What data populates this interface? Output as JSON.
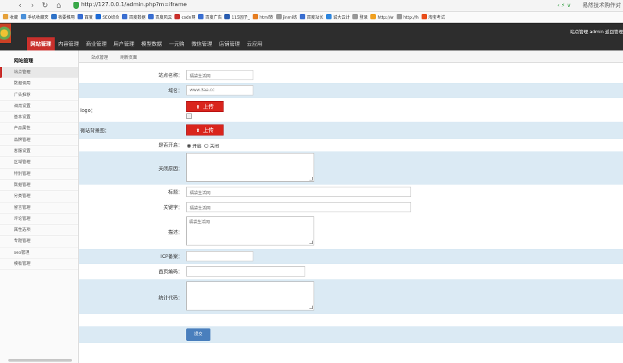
{
  "browser": {
    "url": "http://127.0.0.1/admin.php?m=iframe",
    "right_text": "易然技术购作对",
    "right_icons": "‹ ⚡ ∨"
  },
  "bookmarks": [
    {
      "label": "收藏",
      "color": "#e6a23c"
    },
    {
      "label": "手机收藏夹",
      "color": "#4a90d9"
    },
    {
      "label": "我要推用",
      "color": "#2f73c8"
    },
    {
      "label": "百度",
      "color": "#3b6fd1"
    },
    {
      "label": "SEO综合",
      "color": "#1e6bd6"
    },
    {
      "label": "百度数据",
      "color": "#3b6fd1"
    },
    {
      "label": "百度风云",
      "color": "#3b6fd1"
    },
    {
      "label": "csdn网",
      "color": "#c9302c"
    },
    {
      "label": "百度广告",
      "color": "#3b6fd1"
    },
    {
      "label": "115园子_",
      "color": "#2a5db0"
    },
    {
      "label": "html转",
      "color": "#e67e22"
    },
    {
      "label": "jinmi练",
      "color": "#999999"
    },
    {
      "label": "百度站长",
      "color": "#3b6fd1"
    },
    {
      "label": "诚大云计",
      "color": "#2e86de"
    },
    {
      "label": "登录",
      "color": "#999999"
    },
    {
      "label": "http://w",
      "color": "#f0a020"
    },
    {
      "label": "http://h",
      "color": "#999999"
    },
    {
      "label": "淘宝考试",
      "color": "#e94e1b"
    }
  ],
  "header": {
    "user_info": "站点管理 admin 返回管理",
    "nav": [
      "网站管理",
      "内容管理",
      "商业管理",
      "用户管理",
      "模型数据",
      "一元购",
      "微信管理",
      "店铺管理",
      "云应用"
    ]
  },
  "sidebar": {
    "title": "网站管理",
    "items": [
      "站点管理",
      "数据调用",
      "广告推荐",
      "调用设置",
      "基本设置",
      "产品属性",
      "品牌管理",
      "客服设置",
      "区域管理",
      "特别管理",
      "数据管理",
      "分类管理",
      "留言管理",
      "评论管理",
      "属性选项",
      "专题管理",
      "seo管理",
      "模板管理"
    ]
  },
  "tabs": [
    "站点管理",
    "刷新页面"
  ],
  "form": {
    "site_name_label": "站点名称：",
    "site_name_value": "福袋生活网",
    "domain_label": "域名：",
    "domain_value": "www.3aa.cc",
    "logo_label": "logo：",
    "wechat_bg_label": "微站背景图：",
    "upload_label": "上传",
    "open_label": "是否开启：",
    "open_option": "开启",
    "close_option": "关闭",
    "close_reason_label": "关闭原因：",
    "close_reason_value": "",
    "title_label": "标题：",
    "title_value": "福袋生活网",
    "keywords_label": "关键字：",
    "keywords_value": "福袋生活网",
    "description_label": "描述：",
    "description_value": "福袋生活网",
    "icp_label": "ICP备案：",
    "icp_value": "",
    "home_code_label": "首页编码：",
    "home_code_value": "",
    "stats_label": "统计代码：",
    "stats_value": "",
    "submit_label": "提交"
  }
}
